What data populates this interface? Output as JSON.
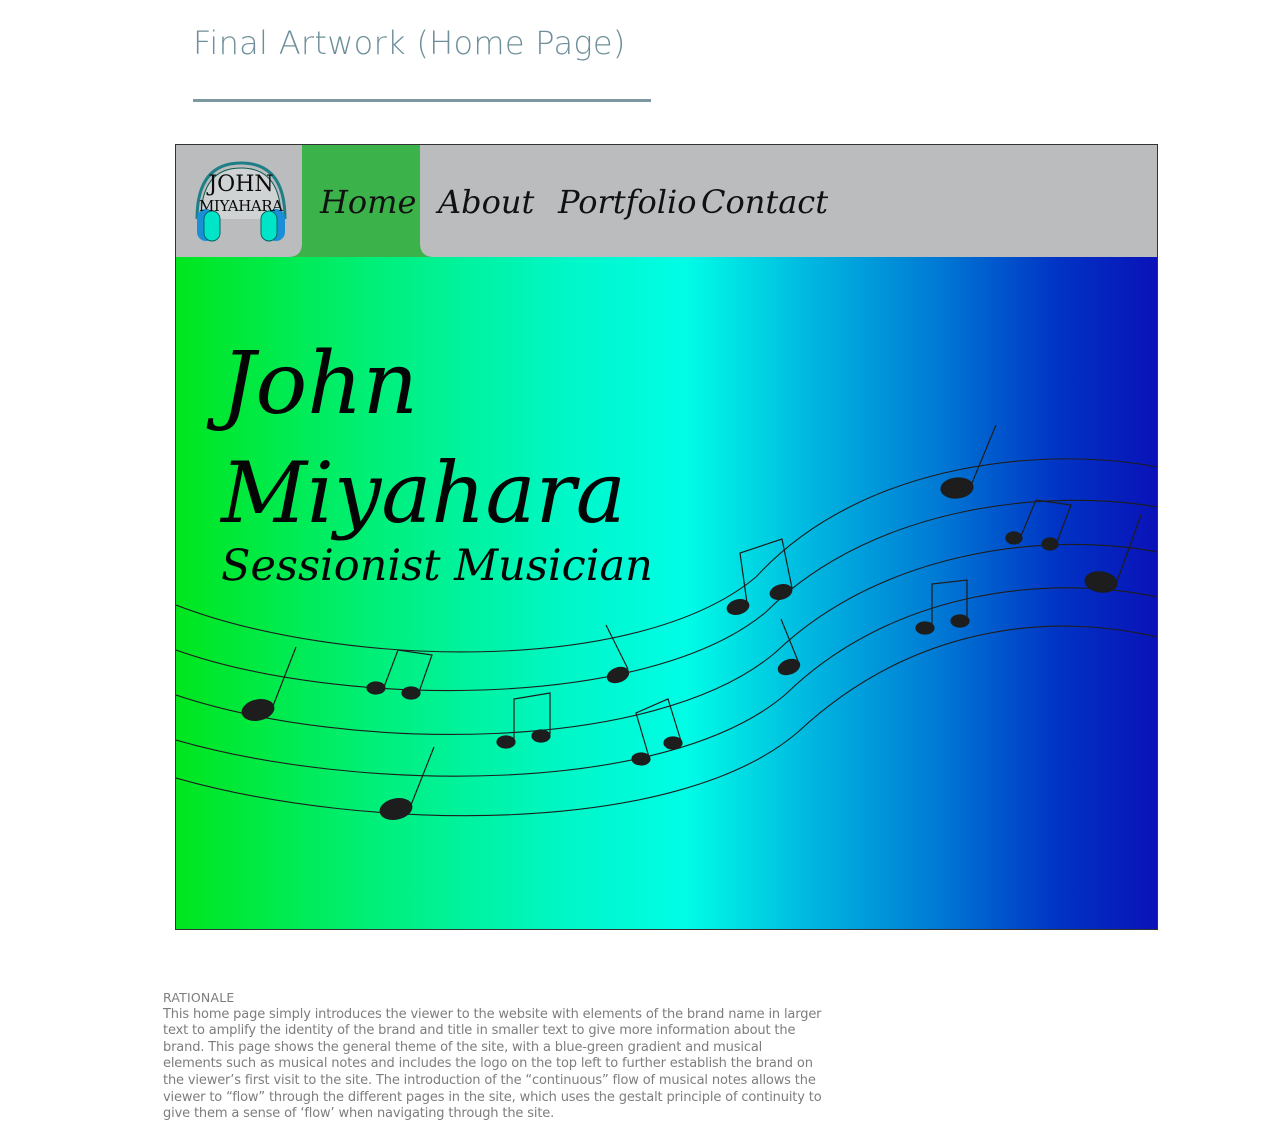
{
  "page": {
    "heading": "Final Artwork (Home Page)"
  },
  "mockup": {
    "logo": {
      "text_line1": "JOHN",
      "text_line2": "MIYAHARA",
      "icon": "headphones-icon"
    },
    "nav": {
      "items": [
        {
          "label": "Home",
          "active": true
        },
        {
          "label": "About",
          "active": false
        },
        {
          "label": "Portfolio",
          "active": false
        },
        {
          "label": "Contact",
          "active": false
        }
      ],
      "active_color": "#3bb34a",
      "bar_color": "#bbbcbe"
    },
    "hero": {
      "name_line1": "John",
      "name_line2": "Miyahara",
      "subtitle": "Sessionist Musician",
      "gradient_colors": [
        "#00e61d",
        "#00fde6",
        "#0a12b8"
      ],
      "decoration": "music-staff-notes"
    }
  },
  "rationale": {
    "title": "RATIONALE",
    "body": "This home page simply introduces the viewer to the website with elements of the brand name in larger text to amplify the identity of the brand and title in smaller text to give more information about the brand. This page shows the general theme of the site, with a blue-green gradient and musical elements such as musical notes and includes the logo on the top left to further establish the brand on the viewer’s first visit to the site. The introduction of the “continuous” flow of musical notes allows the viewer to “flow” through the different pages in the site, which uses the gestalt principle of continuity to give them a sense of ‘flow’ when navigating through the site."
  }
}
